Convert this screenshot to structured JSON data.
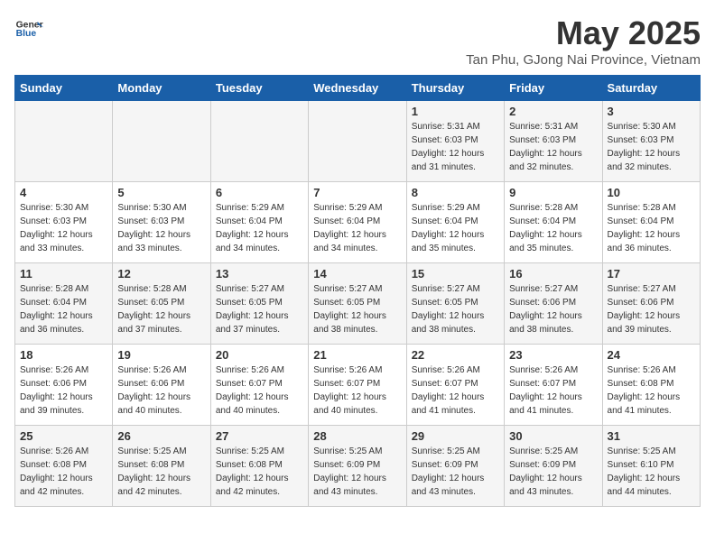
{
  "logo": {
    "text_general": "General",
    "text_blue": "Blue"
  },
  "title": "May 2025",
  "subtitle": "Tan Phu, GJong Nai Province, Vietnam",
  "columns": [
    "Sunday",
    "Monday",
    "Tuesday",
    "Wednesday",
    "Thursday",
    "Friday",
    "Saturday"
  ],
  "weeks": [
    [
      {
        "day": "",
        "info": ""
      },
      {
        "day": "",
        "info": ""
      },
      {
        "day": "",
        "info": ""
      },
      {
        "day": "",
        "info": ""
      },
      {
        "day": "1",
        "info": "Sunrise: 5:31 AM\nSunset: 6:03 PM\nDaylight: 12 hours\nand 31 minutes."
      },
      {
        "day": "2",
        "info": "Sunrise: 5:31 AM\nSunset: 6:03 PM\nDaylight: 12 hours\nand 32 minutes."
      },
      {
        "day": "3",
        "info": "Sunrise: 5:30 AM\nSunset: 6:03 PM\nDaylight: 12 hours\nand 32 minutes."
      }
    ],
    [
      {
        "day": "4",
        "info": "Sunrise: 5:30 AM\nSunset: 6:03 PM\nDaylight: 12 hours\nand 33 minutes."
      },
      {
        "day": "5",
        "info": "Sunrise: 5:30 AM\nSunset: 6:03 PM\nDaylight: 12 hours\nand 33 minutes."
      },
      {
        "day": "6",
        "info": "Sunrise: 5:29 AM\nSunset: 6:04 PM\nDaylight: 12 hours\nand 34 minutes."
      },
      {
        "day": "7",
        "info": "Sunrise: 5:29 AM\nSunset: 6:04 PM\nDaylight: 12 hours\nand 34 minutes."
      },
      {
        "day": "8",
        "info": "Sunrise: 5:29 AM\nSunset: 6:04 PM\nDaylight: 12 hours\nand 35 minutes."
      },
      {
        "day": "9",
        "info": "Sunrise: 5:28 AM\nSunset: 6:04 PM\nDaylight: 12 hours\nand 35 minutes."
      },
      {
        "day": "10",
        "info": "Sunrise: 5:28 AM\nSunset: 6:04 PM\nDaylight: 12 hours\nand 36 minutes."
      }
    ],
    [
      {
        "day": "11",
        "info": "Sunrise: 5:28 AM\nSunset: 6:04 PM\nDaylight: 12 hours\nand 36 minutes."
      },
      {
        "day": "12",
        "info": "Sunrise: 5:28 AM\nSunset: 6:05 PM\nDaylight: 12 hours\nand 37 minutes."
      },
      {
        "day": "13",
        "info": "Sunrise: 5:27 AM\nSunset: 6:05 PM\nDaylight: 12 hours\nand 37 minutes."
      },
      {
        "day": "14",
        "info": "Sunrise: 5:27 AM\nSunset: 6:05 PM\nDaylight: 12 hours\nand 38 minutes."
      },
      {
        "day": "15",
        "info": "Sunrise: 5:27 AM\nSunset: 6:05 PM\nDaylight: 12 hours\nand 38 minutes."
      },
      {
        "day": "16",
        "info": "Sunrise: 5:27 AM\nSunset: 6:06 PM\nDaylight: 12 hours\nand 38 minutes."
      },
      {
        "day": "17",
        "info": "Sunrise: 5:27 AM\nSunset: 6:06 PM\nDaylight: 12 hours\nand 39 minutes."
      }
    ],
    [
      {
        "day": "18",
        "info": "Sunrise: 5:26 AM\nSunset: 6:06 PM\nDaylight: 12 hours\nand 39 minutes."
      },
      {
        "day": "19",
        "info": "Sunrise: 5:26 AM\nSunset: 6:06 PM\nDaylight: 12 hours\nand 40 minutes."
      },
      {
        "day": "20",
        "info": "Sunrise: 5:26 AM\nSunset: 6:07 PM\nDaylight: 12 hours\nand 40 minutes."
      },
      {
        "day": "21",
        "info": "Sunrise: 5:26 AM\nSunset: 6:07 PM\nDaylight: 12 hours\nand 40 minutes."
      },
      {
        "day": "22",
        "info": "Sunrise: 5:26 AM\nSunset: 6:07 PM\nDaylight: 12 hours\nand 41 minutes."
      },
      {
        "day": "23",
        "info": "Sunrise: 5:26 AM\nSunset: 6:07 PM\nDaylight: 12 hours\nand 41 minutes."
      },
      {
        "day": "24",
        "info": "Sunrise: 5:26 AM\nSunset: 6:08 PM\nDaylight: 12 hours\nand 41 minutes."
      }
    ],
    [
      {
        "day": "25",
        "info": "Sunrise: 5:26 AM\nSunset: 6:08 PM\nDaylight: 12 hours\nand 42 minutes."
      },
      {
        "day": "26",
        "info": "Sunrise: 5:25 AM\nSunset: 6:08 PM\nDaylight: 12 hours\nand 42 minutes."
      },
      {
        "day": "27",
        "info": "Sunrise: 5:25 AM\nSunset: 6:08 PM\nDaylight: 12 hours\nand 42 minutes."
      },
      {
        "day": "28",
        "info": "Sunrise: 5:25 AM\nSunset: 6:09 PM\nDaylight: 12 hours\nand 43 minutes."
      },
      {
        "day": "29",
        "info": "Sunrise: 5:25 AM\nSunset: 6:09 PM\nDaylight: 12 hours\nand 43 minutes."
      },
      {
        "day": "30",
        "info": "Sunrise: 5:25 AM\nSunset: 6:09 PM\nDaylight: 12 hours\nand 43 minutes."
      },
      {
        "day": "31",
        "info": "Sunrise: 5:25 AM\nSunset: 6:10 PM\nDaylight: 12 hours\nand 44 minutes."
      }
    ]
  ]
}
